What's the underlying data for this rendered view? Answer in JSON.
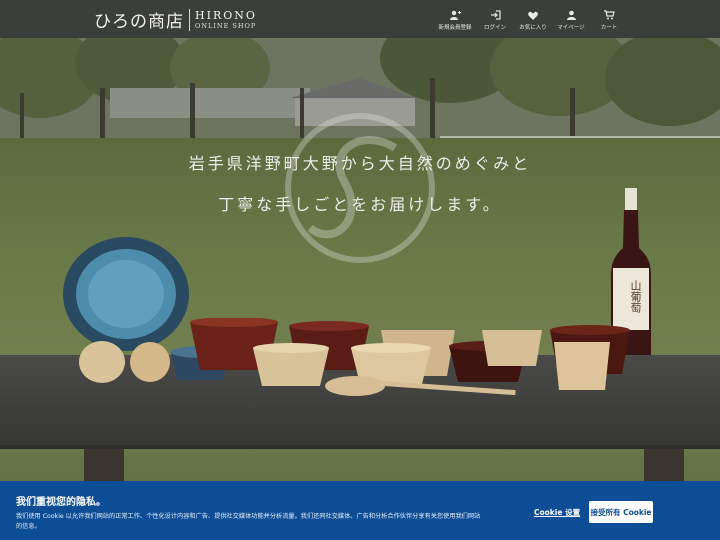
{
  "header": {
    "logo_jp": "ひろの商店",
    "logo_en": "HIRONO",
    "logo_en_sub": "ONLINE SHOP",
    "nav": [
      {
        "label": "新規会員登録",
        "icon": "user-plus-icon"
      },
      {
        "label": "ログイン",
        "icon": "login-icon"
      },
      {
        "label": "お気に入り",
        "icon": "heart-icon"
      },
      {
        "label": "マイページ",
        "icon": "user-icon"
      },
      {
        "label": "カート",
        "icon": "cart-icon"
      }
    ]
  },
  "hero": {
    "line1": "岩手県洋野町大野から大自然のめぐみと",
    "line2": "丁寧な手しごとをお届けします。",
    "bottle_label": "山葡萄"
  },
  "cookie": {
    "title": "我们重视您的隐私。",
    "text": "我们使用 Cookie 以允许我们网站的正常工作、个性化设计内容和广告、提供社交媒体功能并分析流量。我们还同社交媒体、广告和分析合作伙伴分享有关您使用我们网站的信息。",
    "settings_label": "Cookie 设置",
    "accept_label": "接受所有 Cookie"
  },
  "colors": {
    "header_bg": "#343734",
    "cookie_bg": "#0d4d96"
  }
}
